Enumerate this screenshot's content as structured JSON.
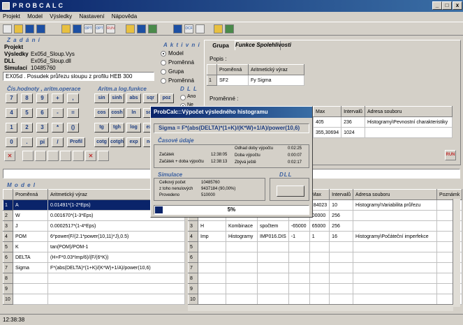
{
  "window": {
    "title": "PROBCALC",
    "min": "_",
    "max": "□",
    "close": "x"
  },
  "menu": [
    "Projekt",
    "Model",
    "Výsledky",
    "Nastavení",
    "Nápověda"
  ],
  "toolbar_labels": {
    "opt1": "OPT",
    "opt2": "OPT",
    "run": "RUN",
    "dcf": "DCF"
  },
  "zadani": {
    "section": "Z a d á n í",
    "labels": [
      "Projekt",
      "Výsledky",
      "DLL",
      "Simulací"
    ],
    "values": [
      "",
      "Ex05d_Sloup.Vys",
      "Ex05d_Sloup.dll",
      "10485760"
    ],
    "description": "EX05d . Posudek průřezu sloupu z profilu HEB 300"
  },
  "aktivni": {
    "section": "A k t i v n í",
    "options": [
      "Model",
      "Proměnná",
      "Grupa",
      "Proměnná"
    ],
    "selected": 0
  },
  "calc": {
    "sec1": "Čís.hodnoty , aritm.operace",
    "sec2": "Aritm.a log.funkce",
    "sec3": "D L L",
    "num_keys": [
      "7",
      "8",
      "9",
      "+",
      ",",
      "4",
      "5",
      "6",
      "-",
      "=",
      "1",
      "2",
      "3",
      "*",
      "()",
      "0",
      ".",
      "pi",
      "/",
      "Profil"
    ],
    "fn_keys": [
      "sin",
      "sinh",
      "abs",
      "sqr",
      "poz",
      "cos",
      "cosh",
      "ln",
      "sqrt",
      "tg",
      "tgh",
      "log",
      "exp",
      "cotg",
      "cotgh",
      "exp",
      "not"
    ],
    "dll_options": [
      "Ano",
      "Ne"
    ]
  },
  "tabs": [
    "Grupa",
    "Funkce Spolehlivosti"
  ],
  "popis": {
    "label": "Popis :",
    "headers": [
      "Proměnná",
      "Aritmetický výraz"
    ],
    "rows": [
      {
        "n": "1",
        "var": "SF2",
        "expr": "Fy Sigma"
      }
    ]
  },
  "promenne_top": {
    "label": "Proměnné :",
    "headers": [
      "Max",
      "Intervalů",
      "Adresa souboru"
    ],
    "rows": [
      {
        "max": "405",
        "int": "236",
        "addr": "Histogramy\\Pevnostní charakteristiky"
      },
      {
        "max": "355,30694",
        "int": "1024",
        "addr": ""
      }
    ]
  },
  "run_label": "RUN",
  "model": {
    "section": "M o d e l",
    "headers": [
      "Proměnná",
      "Aritmetický výraz"
    ],
    "rows": [
      {
        "n": "1",
        "var": "A",
        "expr": "0.01491*(1-2*Eps)"
      },
      {
        "n": "2",
        "var": "W",
        "expr": "0.001670*(1-3*Eps)"
      },
      {
        "n": "3",
        "var": "J",
        "expr": "0.0002517*(1-4*Eps)"
      },
      {
        "n": "4",
        "var": "POM",
        "expr": "6*power(F/(2.1*power(10,11)*J),0.5)"
      },
      {
        "n": "5",
        "var": "K",
        "expr": "tan(POM)/POM-1"
      },
      {
        "n": "6",
        "var": "DELTA",
        "expr": "(H+F*0.03*Imp/6)/(F/(6*K))"
      },
      {
        "n": "7",
        "var": "Sigma",
        "expr": "F*(abs(DELTA)*(1+K)/(K*W)+1/A)/power(10,6)"
      },
      {
        "n": "8",
        "var": "",
        "expr": ""
      },
      {
        "n": "9",
        "var": "",
        "expr": ""
      },
      {
        "n": "10",
        "var": "",
        "expr": ""
      }
    ]
  },
  "variables": {
    "headers": [
      "Max",
      "Intervalů",
      "Adresa souboru",
      "Poznámk"
    ],
    "rows": [
      {
        "n": "1",
        "name": "",
        "type": "",
        "a": "",
        "min": "",
        "max": ".84023",
        "int": "10",
        "addr": "Histogramy\\Variabilita průřezu"
      },
      {
        "n": "2",
        "name": "",
        "type": "",
        "a": "",
        "min": "",
        "max": "00000",
        "int": "256",
        "addr": ""
      },
      {
        "n": "3",
        "name": "H",
        "type": "Kombinace",
        "a": "spočtem",
        "min": "-65000",
        "max": "65000",
        "int": "256",
        "addr": ""
      },
      {
        "n": "4",
        "name": "Imp",
        "type": "Histogramy",
        "a": "IMP016.DIS",
        "min": "-1",
        "max": "1",
        "int": "16",
        "addr": "Histogramy\\Počáteční imperfekce"
      },
      {
        "n": "5",
        "name": "",
        "type": "",
        "a": "",
        "min": "",
        "max": "",
        "int": "",
        "addr": ""
      },
      {
        "n": "6",
        "name": "",
        "type": "",
        "a": "",
        "min": "",
        "max": "",
        "int": "",
        "addr": ""
      },
      {
        "n": "7",
        "name": "",
        "type": "",
        "a": "",
        "min": "",
        "max": "",
        "int": "",
        "addr": ""
      },
      {
        "n": "8",
        "name": "",
        "type": "",
        "a": "",
        "min": "",
        "max": "",
        "int": "",
        "addr": ""
      },
      {
        "n": "9",
        "name": "",
        "type": "",
        "a": "",
        "min": "",
        "max": "",
        "int": "",
        "addr": ""
      },
      {
        "n": "10",
        "name": "",
        "type": "",
        "a": "",
        "min": "",
        "max": "",
        "int": "",
        "addr": ""
      }
    ]
  },
  "dialog": {
    "title": "ProbCalc::Výpočet výsledného histogramu",
    "formula": "Sigma = F*(abs(DELTA)*(1+K)/(K*W)+1/A)/power(10,6)",
    "time_section": "Časové údaje",
    "start_label": "Začátek",
    "start_val": "12:38:05",
    "start_plus_label": "Začátek + doba výpočtu",
    "start_plus_val": "12:38:13",
    "est_label": "Odhad doby výpočtu",
    "est_val": "0:02:25",
    "dur_label": "Doba výpočtu",
    "dur_val": "0:00:07",
    "remain_label": "Zbývá ještě",
    "remain_val": "0:02:17",
    "sim_section": "Simulace",
    "total_label": "Celkový počet",
    "total_val": "10485760",
    "nonzero_label": "z toho nenulových",
    "nonzero_val": "9437184 (90,00%)",
    "done_label": "Provedeno",
    "done_val": "510000",
    "dll_section": "DLL",
    "progress_text": "5%",
    "progress": 0.05
  },
  "status": {
    "time": "12:38:38"
  }
}
